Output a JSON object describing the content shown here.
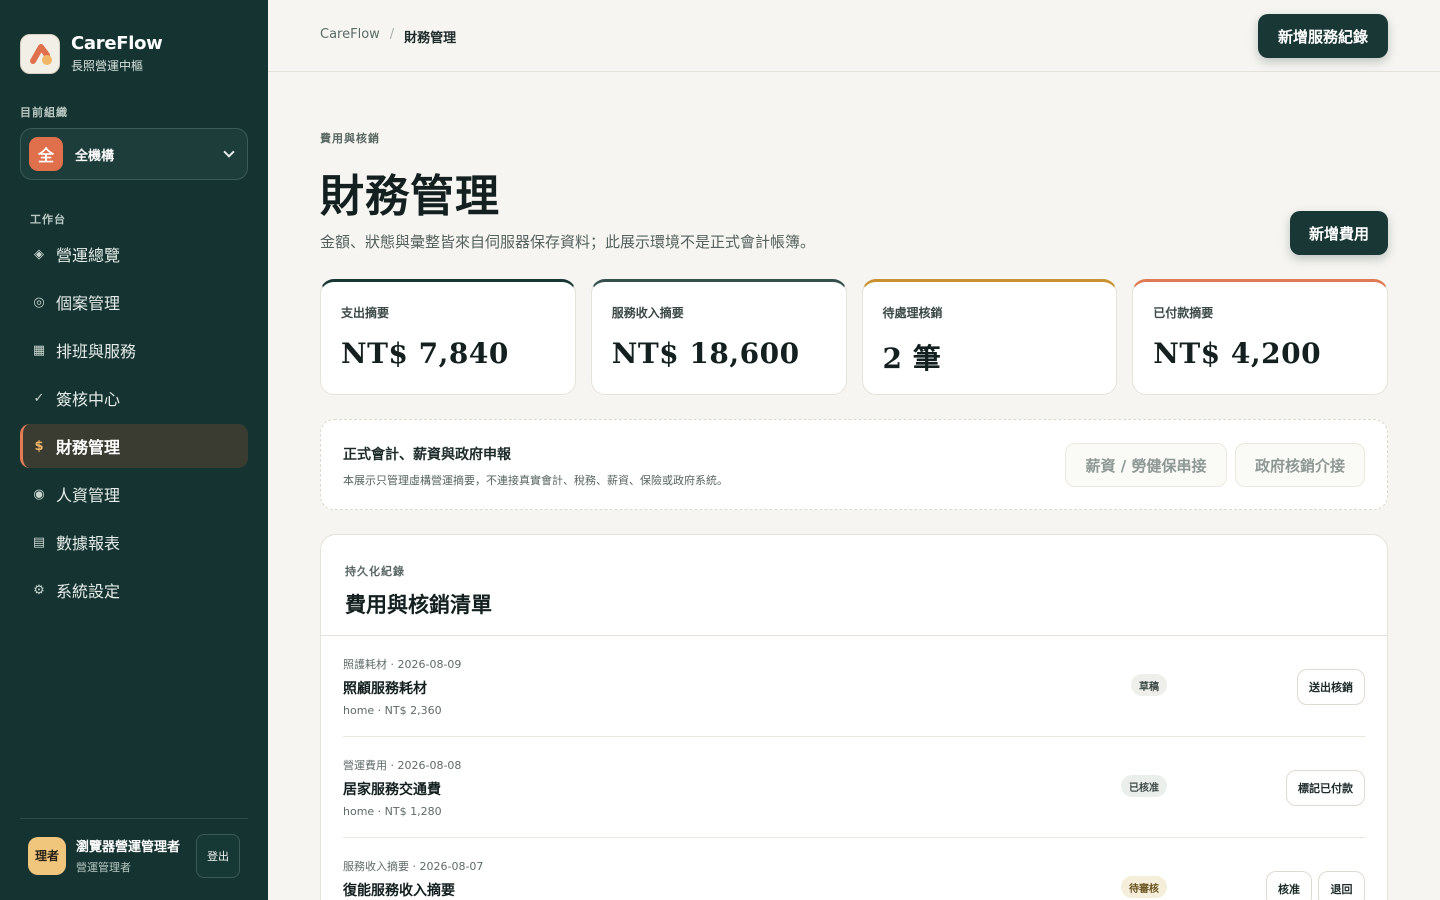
{
  "brand": {
    "name": "CareFlow",
    "subtitle": "長照營運中樞"
  },
  "org": {
    "label": "目前組織",
    "avatar": "全",
    "name": "全機構"
  },
  "nav": {
    "label": "工作台",
    "items": [
      {
        "icon": "◈",
        "label": "營運總覽"
      },
      {
        "icon": "◎",
        "label": "個案管理"
      },
      {
        "icon": "▦",
        "label": "排班與服務"
      },
      {
        "icon": "✓",
        "label": "簽核中心"
      },
      {
        "icon": "$",
        "label": "財務管理"
      },
      {
        "icon": "◉",
        "label": "人資管理"
      },
      {
        "icon": "▤",
        "label": "數據報表"
      },
      {
        "icon": "⚙",
        "label": "系統設定"
      }
    ]
  },
  "user": {
    "avatar": "理者",
    "name": "瀏覽器營運管理者",
    "role": "營運管理者",
    "logout": "登出"
  },
  "breadcrumb": {
    "root": "CareFlow",
    "sep": "/",
    "current": "財務管理"
  },
  "actions": {
    "new_service_record": "新增服務紀錄",
    "new_expense": "新增費用"
  },
  "header": {
    "eyebrow": "費用與核銷",
    "title": "財務管理",
    "description": "金額、狀態與彙整皆來自伺服器保存資料；此展示環境不是正式會計帳簿。"
  },
  "stats": [
    {
      "label": "支出摘要",
      "value": "NT$ 7,840"
    },
    {
      "label": "服務收入摘要",
      "value": "NT$ 18,600"
    },
    {
      "label": "待處理核銷",
      "value": "2 筆"
    },
    {
      "label": "已付款摘要",
      "value": "NT$ 4,200"
    }
  ],
  "notice": {
    "title": "正式會計、薪資與政府申報",
    "description": "本展示只管理虛構營運摘要，不連接真實會計、稅務、薪資、保險或政府系統。",
    "button1": "薪資 / 勞健保串接",
    "button2": "政府核銷介接"
  },
  "list": {
    "eyebrow": "持久化紀錄",
    "title": "費用與核銷清單",
    "rows": [
      {
        "meta": "照護耗材 · 2026-08-09",
        "title": "照顧服務耗材",
        "sub": "home · NT$ 2,360",
        "status": "草稿",
        "actions": [
          "送出核銷"
        ]
      },
      {
        "meta": "營運費用 · 2026-08-08",
        "title": "居家服務交通費",
        "sub": "home · NT$ 1,280",
        "status": "已核准",
        "actions": [
          "標記已付款"
        ]
      },
      {
        "meta": "服務收入摘要 · 2026-08-07",
        "title": "復能服務收入摘要",
        "sub": "",
        "status": "待審核",
        "actions": [
          "核准",
          "退回"
        ]
      }
    ]
  },
  "colors": {
    "sidebar": "#153431",
    "accent": "#e07a55",
    "primary": "#183735",
    "background": "#f6f5f1"
  }
}
